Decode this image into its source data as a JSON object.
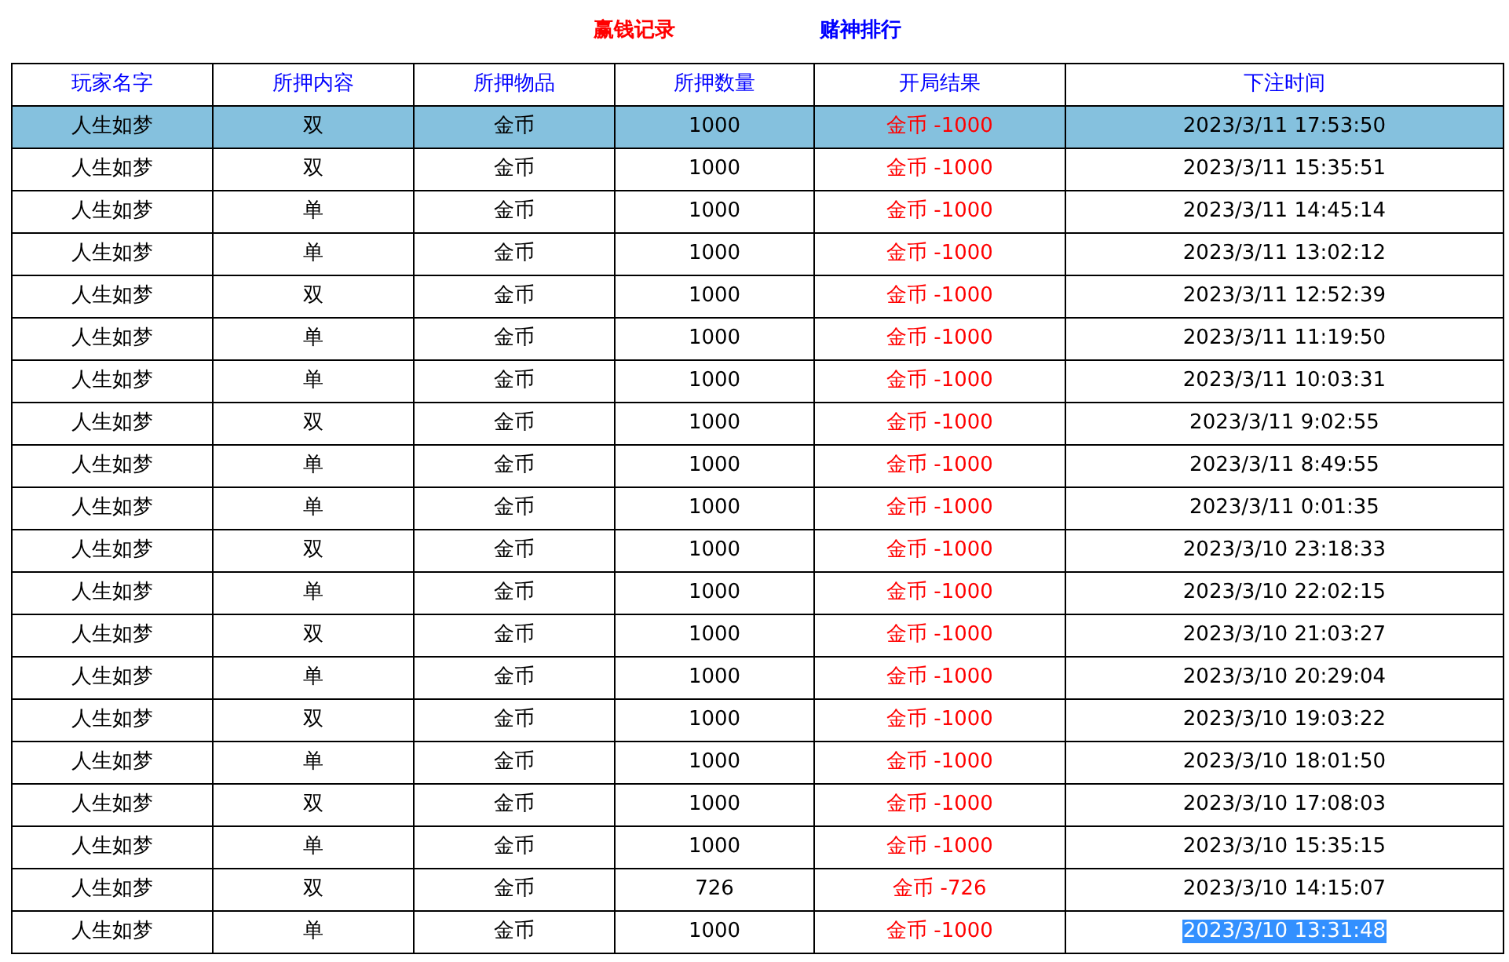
{
  "nav_links": [
    {
      "label": "赢钱记录",
      "kind": "win"
    },
    {
      "label": "赌神排行",
      "kind": "rank"
    }
  ],
  "table": {
    "columns": [
      "玩家名字",
      "所押内容",
      "所押物品",
      "所押数量",
      "开局结果",
      "下注时间"
    ],
    "rows": [
      {
        "player": "人生如梦",
        "bet": "双",
        "item": "金币",
        "amount": "1000",
        "result": "金币 -1000",
        "time": "2023/3/11 17:53:50",
        "selected": true,
        "time_highlighted": false
      },
      {
        "player": "人生如梦",
        "bet": "双",
        "item": "金币",
        "amount": "1000",
        "result": "金币 -1000",
        "time": "2023/3/11 15:35:51",
        "selected": false,
        "time_highlighted": false
      },
      {
        "player": "人生如梦",
        "bet": "单",
        "item": "金币",
        "amount": "1000",
        "result": "金币 -1000",
        "time": "2023/3/11 14:45:14",
        "selected": false,
        "time_highlighted": false
      },
      {
        "player": "人生如梦",
        "bet": "单",
        "item": "金币",
        "amount": "1000",
        "result": "金币 -1000",
        "time": "2023/3/11 13:02:12",
        "selected": false,
        "time_highlighted": false
      },
      {
        "player": "人生如梦",
        "bet": "双",
        "item": "金币",
        "amount": "1000",
        "result": "金币 -1000",
        "time": "2023/3/11 12:52:39",
        "selected": false,
        "time_highlighted": false
      },
      {
        "player": "人生如梦",
        "bet": "单",
        "item": "金币",
        "amount": "1000",
        "result": "金币 -1000",
        "time": "2023/3/11 11:19:50",
        "selected": false,
        "time_highlighted": false
      },
      {
        "player": "人生如梦",
        "bet": "单",
        "item": "金币",
        "amount": "1000",
        "result": "金币 -1000",
        "time": "2023/3/11 10:03:31",
        "selected": false,
        "time_highlighted": false
      },
      {
        "player": "人生如梦",
        "bet": "双",
        "item": "金币",
        "amount": "1000",
        "result": "金币 -1000",
        "time": "2023/3/11 9:02:55",
        "selected": false,
        "time_highlighted": false
      },
      {
        "player": "人生如梦",
        "bet": "单",
        "item": "金币",
        "amount": "1000",
        "result": "金币 -1000",
        "time": "2023/3/11 8:49:55",
        "selected": false,
        "time_highlighted": false
      },
      {
        "player": "人生如梦",
        "bet": "单",
        "item": "金币",
        "amount": "1000",
        "result": "金币 -1000",
        "time": "2023/3/11 0:01:35",
        "selected": false,
        "time_highlighted": false
      },
      {
        "player": "人生如梦",
        "bet": "双",
        "item": "金币",
        "amount": "1000",
        "result": "金币 -1000",
        "time": "2023/3/10 23:18:33",
        "selected": false,
        "time_highlighted": false
      },
      {
        "player": "人生如梦",
        "bet": "单",
        "item": "金币",
        "amount": "1000",
        "result": "金币 -1000",
        "time": "2023/3/10 22:02:15",
        "selected": false,
        "time_highlighted": false
      },
      {
        "player": "人生如梦",
        "bet": "双",
        "item": "金币",
        "amount": "1000",
        "result": "金币 -1000",
        "time": "2023/3/10 21:03:27",
        "selected": false,
        "time_highlighted": false
      },
      {
        "player": "人生如梦",
        "bet": "单",
        "item": "金币",
        "amount": "1000",
        "result": "金币 -1000",
        "time": "2023/3/10 20:29:04",
        "selected": false,
        "time_highlighted": false
      },
      {
        "player": "人生如梦",
        "bet": "双",
        "item": "金币",
        "amount": "1000",
        "result": "金币 -1000",
        "time": "2023/3/10 19:03:22",
        "selected": false,
        "time_highlighted": false
      },
      {
        "player": "人生如梦",
        "bet": "单",
        "item": "金币",
        "amount": "1000",
        "result": "金币 -1000",
        "time": "2023/3/10 18:01:50",
        "selected": false,
        "time_highlighted": false
      },
      {
        "player": "人生如梦",
        "bet": "双",
        "item": "金币",
        "amount": "1000",
        "result": "金币 -1000",
        "time": "2023/3/10 17:08:03",
        "selected": false,
        "time_highlighted": false
      },
      {
        "player": "人生如梦",
        "bet": "单",
        "item": "金币",
        "amount": "1000",
        "result": "金币 -1000",
        "time": "2023/3/10 15:35:15",
        "selected": false,
        "time_highlighted": false
      },
      {
        "player": "人生如梦",
        "bet": "双",
        "item": "金币",
        "amount": "726",
        "result": "金币 -726",
        "time": "2023/3/10 14:15:07",
        "selected": false,
        "time_highlighted": false
      },
      {
        "player": "人生如梦",
        "bet": "单",
        "item": "金币",
        "amount": "1000",
        "result": "金币 -1000",
        "time": "2023/3/10 13:31:48",
        "selected": false,
        "time_highlighted": true
      }
    ]
  }
}
